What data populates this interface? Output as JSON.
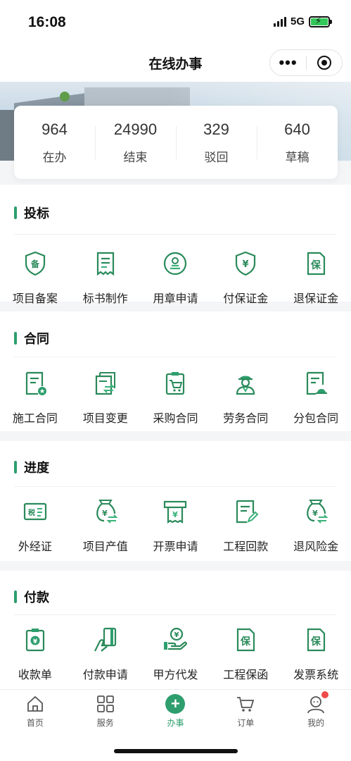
{
  "status_bar": {
    "time": "16:08",
    "network": "5G"
  },
  "nav": {
    "title": "在线办事"
  },
  "stats": [
    {
      "value": "964",
      "label": "在办"
    },
    {
      "value": "24990",
      "label": "结束"
    },
    {
      "value": "329",
      "label": "驳回"
    },
    {
      "value": "640",
      "label": "草稿"
    }
  ],
  "sections": [
    {
      "title": "投标",
      "items": [
        {
          "label": "项目备案",
          "icon": "shield-bei-icon"
        },
        {
          "label": "标书制作",
          "icon": "document-lines-icon"
        },
        {
          "label": "用章申请",
          "icon": "seal-icon"
        },
        {
          "label": "付保证金",
          "icon": "shield-yuan-icon"
        },
        {
          "label": "退保证金",
          "icon": "doc-bao-icon"
        }
      ]
    },
    {
      "title": "合同",
      "items": [
        {
          "label": "施工合同",
          "icon": "contract-star-icon"
        },
        {
          "label": "项目变更",
          "icon": "swap-doc-icon"
        },
        {
          "label": "采购合同",
          "icon": "cart-clipboard-icon"
        },
        {
          "label": "劳务合同",
          "icon": "worker-icon"
        },
        {
          "label": "分包合同",
          "icon": "helmet-doc-icon"
        }
      ]
    },
    {
      "title": "进度",
      "items": [
        {
          "label": "外经证",
          "icon": "tax-card-icon"
        },
        {
          "label": "项目产值",
          "icon": "money-bag-icon"
        },
        {
          "label": "开票申请",
          "icon": "invoice-print-icon"
        },
        {
          "label": "工程回款",
          "icon": "doc-pen-icon"
        },
        {
          "label": "退风险金",
          "icon": "money-bag-return-icon"
        }
      ]
    },
    {
      "title": "付款",
      "items": [
        {
          "label": "收款单",
          "icon": "receipt-clipboard-icon"
        },
        {
          "label": "付款申请",
          "icon": "card-hand-icon"
        },
        {
          "label": "甲方代发",
          "icon": "hand-coin-icon"
        },
        {
          "label": "工程保函",
          "icon": "doc-bao-icon"
        },
        {
          "label": "发票系统",
          "icon": "doc-bao-icon"
        }
      ]
    }
  ],
  "tabs": [
    {
      "label": "首页",
      "icon": "home-icon"
    },
    {
      "label": "服务",
      "icon": "grid-icon"
    },
    {
      "label": "办事",
      "icon": "plus-icon",
      "active": true
    },
    {
      "label": "订单",
      "icon": "cart-icon"
    },
    {
      "label": "我的",
      "icon": "person-icon",
      "badge": true
    }
  ],
  "colors": {
    "accent": "#2e9e6e",
    "badge": "#f04a4a"
  }
}
